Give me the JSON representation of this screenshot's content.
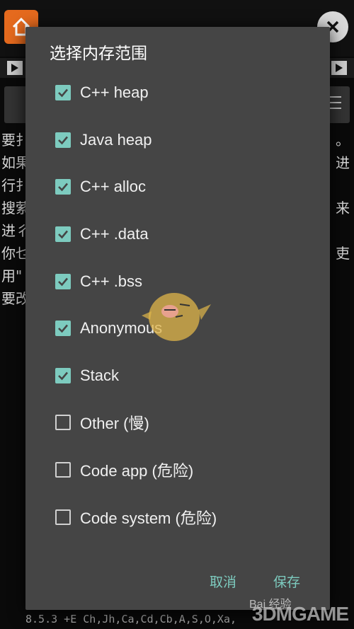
{
  "background": {
    "text_lines": [
      {
        "left": "要扌",
        "right": "。"
      },
      {
        "left": "如果",
        "right": "进"
      },
      {
        "left": "行扌",
        "right": ""
      },
      {
        "left": "搜萦",
        "right": "来"
      },
      {
        "left": "进彳",
        "right": ""
      },
      {
        "left": "你乜",
        "right": "吏"
      },
      {
        "left": "用\"",
        "right": ""
      },
      {
        "left": "要改",
        "right": ""
      }
    ],
    "status_line": "8.5.3  +E Ch,Jh,Ca,Cd,Cb,A,S,O,Xa,",
    "watermark_3dm": "3DMGAME",
    "watermark_baidu": "Bai 经验"
  },
  "dialog": {
    "title": "选择内存范围",
    "options": [
      {
        "label": "C++ heap",
        "checked": true
      },
      {
        "label": "Java heap",
        "checked": true
      },
      {
        "label": "C++ alloc",
        "checked": true
      },
      {
        "label": "C++ .data",
        "checked": true
      },
      {
        "label": "C++ .bss",
        "checked": true
      },
      {
        "label": "Anonymous",
        "checked": true
      },
      {
        "label": "Stack",
        "checked": true
      },
      {
        "label": "Other (慢)",
        "checked": false
      },
      {
        "label": "Code app (危险)",
        "checked": false
      },
      {
        "label": "Code system (危险)",
        "checked": false
      }
    ],
    "cancel_label": "取消",
    "save_label": "保存"
  },
  "colors": {
    "accent": "#7dcbbf",
    "dialog_bg": "#454545",
    "home_button": "#e56a1e"
  }
}
